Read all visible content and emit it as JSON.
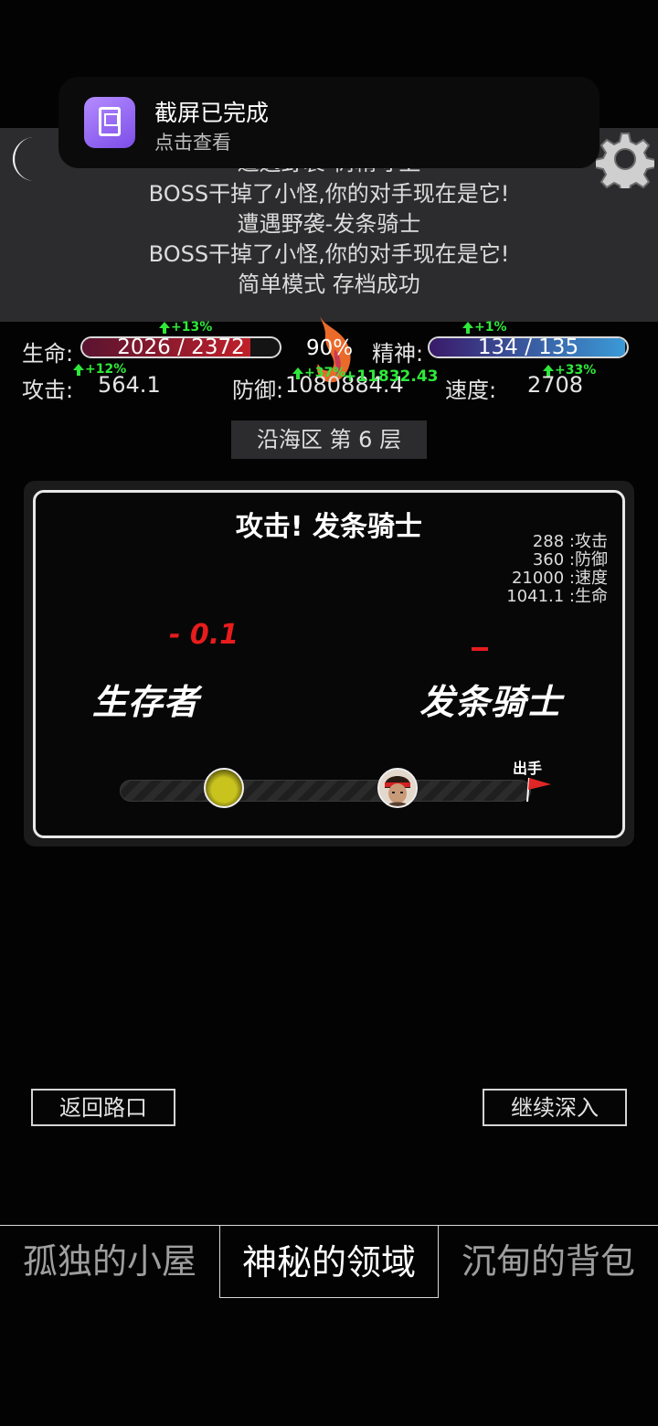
{
  "notification": {
    "title": "截屏已完成",
    "subtitle": "点击查看"
  },
  "battle_log": [
    "遭遇野袭-树精守卫",
    "BOSS干掉了小怪,你的对手现在是它!",
    "遭遇野袭-发条骑士",
    "BOSS干掉了小怪,你的对手现在是它!",
    "简单模式 存档成功"
  ],
  "icons": {
    "moon": "moon-icon",
    "settings": "gear-icon",
    "flame": "flame-icon",
    "flag": "red-flag-icon"
  },
  "player": {
    "hp_label": "生命:",
    "hp_text": "2026 / 2372",
    "hp_boost": "+13%",
    "hp_fill": 0.854,
    "spirit_pct": "90%",
    "mp_label": "精神:",
    "mp_text": "134 / 135",
    "mp_boost": "+1%",
    "mp_fill": 0.993,
    "attack_label": "攻击:",
    "attack_value": "564.1",
    "attack_boost": "+12%",
    "defense_label": "防御:",
    "defense_value": "1080884.4",
    "defense_boost": "+37%",
    "defense_extra": "+11832.43",
    "speed_label": "速度:",
    "speed_value": "2708",
    "speed_boost": "+33%"
  },
  "zone": "沿海区 第 6 层",
  "battle": {
    "title": "攻击! 发条骑士",
    "enemy_stats": [
      "288 :攻击",
      "360 :防御",
      "21000 :速度",
      "1041.1 :生命"
    ],
    "damage_text": "- 0.1",
    "player_name": "生存者",
    "enemy_name": "发条骑士",
    "turn_label": "出手"
  },
  "actions": {
    "back": "返回路口",
    "continue": "继续深入"
  },
  "tabs": [
    {
      "label": "孤独的小屋",
      "active": false
    },
    {
      "label": "神秘的领域",
      "active": true
    },
    {
      "label": "沉甸的背包",
      "active": false
    }
  ],
  "colors": {
    "hp_bar": "#c0202a",
    "mp_bar": "#3a9ad6",
    "boost": "#2ee83a",
    "damage": "#e81c1c"
  }
}
